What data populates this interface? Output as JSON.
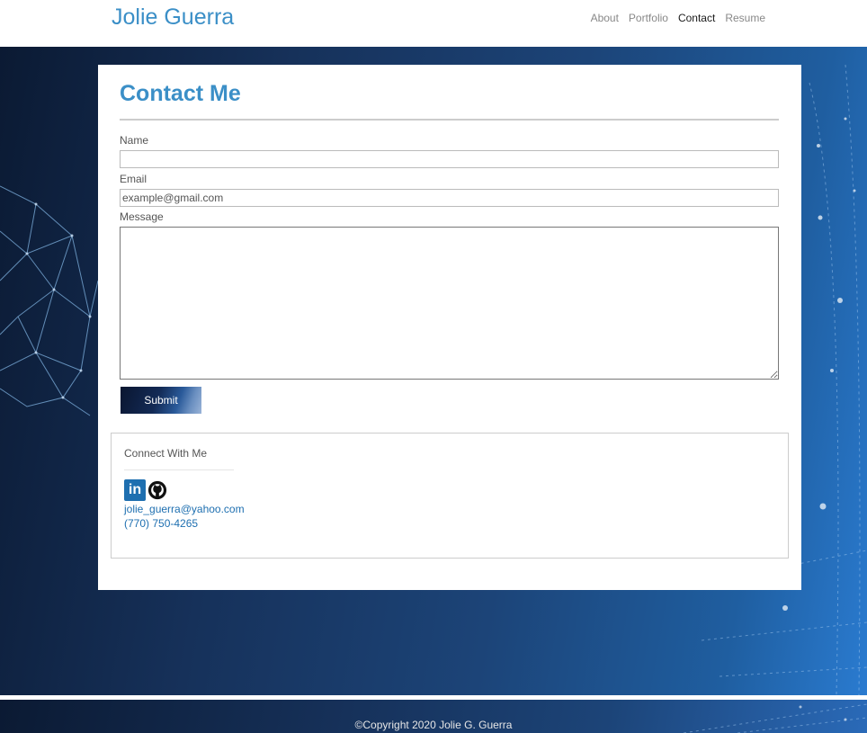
{
  "header": {
    "brand": "Jolie Guerra",
    "nav": [
      {
        "label": "About"
      },
      {
        "label": "Portfolio"
      },
      {
        "label": "Contact"
      },
      {
        "label": "Resume"
      }
    ],
    "active_nav": "Contact"
  },
  "contact": {
    "title": "Contact Me",
    "name_label": "Name",
    "name_value": "",
    "email_label": "Email",
    "email_placeholder": "example@gmail.com",
    "message_label": "Message",
    "message_value": "",
    "submit_label": "Submit"
  },
  "connect": {
    "title": "Connect With Me",
    "icons": [
      "linkedin-icon",
      "github-icon"
    ],
    "email": "jolie_guerra@yahoo.com",
    "phone": "(770) 750-4265"
  },
  "footer": {
    "copyright": "©Copyright 2020 Jolie G. Guerra"
  },
  "colors": {
    "accent": "#3b8fc7",
    "link": "#1e6fb0",
    "background_dark": "#0b1a33",
    "background_light": "#2a7bd0"
  }
}
